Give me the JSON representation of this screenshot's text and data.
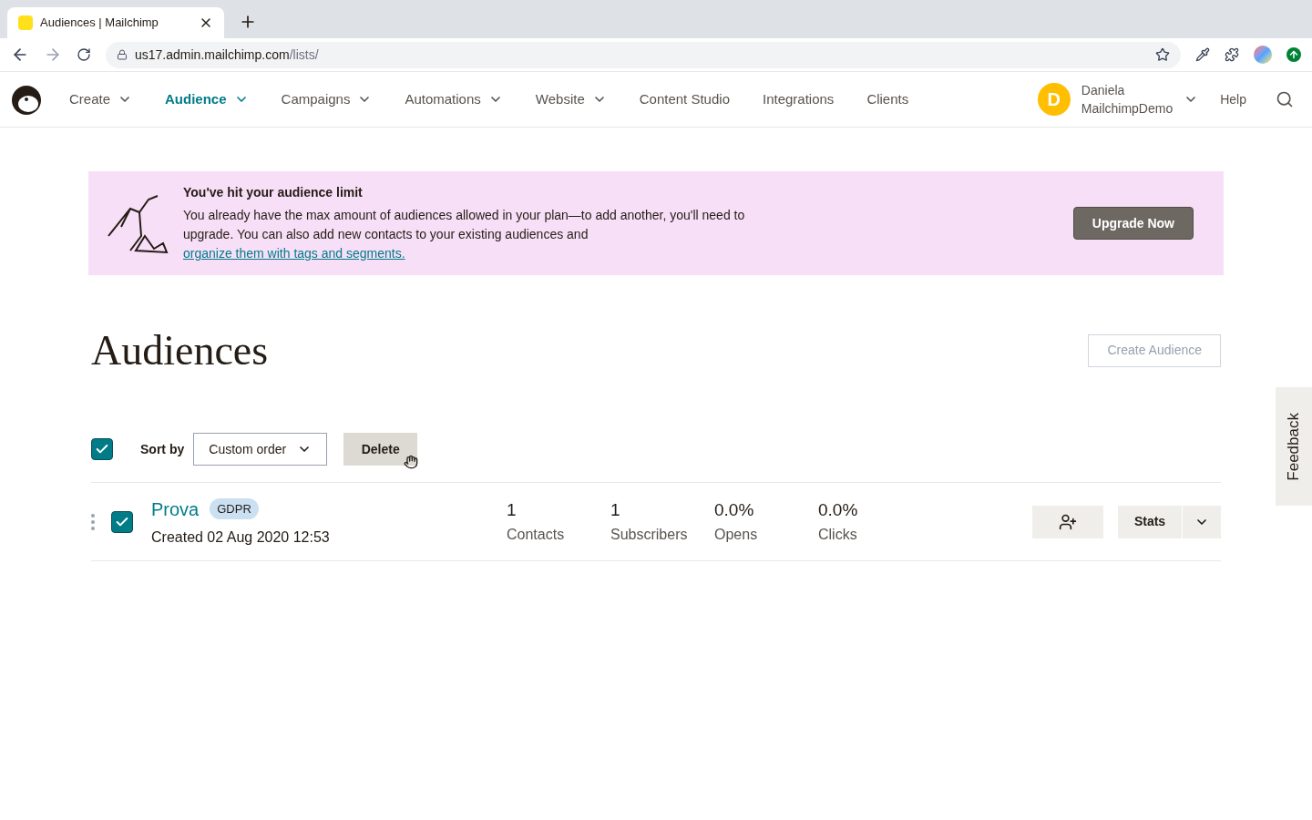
{
  "browser": {
    "tab_title": "Audiences | Mailchimp",
    "url_host": "us17.admin.mailchimp.com",
    "url_path": "/lists/"
  },
  "nav": {
    "items": [
      {
        "label": "Create",
        "dropdown": true,
        "selected": false
      },
      {
        "label": "Audience",
        "dropdown": true,
        "selected": true
      },
      {
        "label": "Campaigns",
        "dropdown": true,
        "selected": false
      },
      {
        "label": "Automations",
        "dropdown": true,
        "selected": false
      },
      {
        "label": "Website",
        "dropdown": true,
        "selected": false
      },
      {
        "label": "Content Studio",
        "dropdown": false,
        "selected": false
      },
      {
        "label": "Integrations",
        "dropdown": false,
        "selected": false
      },
      {
        "label": "Clients",
        "dropdown": false,
        "selected": false
      }
    ],
    "user": {
      "initial": "D",
      "first_name": "Daniela",
      "last_name": "MailchimpDemo"
    },
    "help": "Help"
  },
  "banner": {
    "title": "You've hit your audience limit",
    "body": "You already have the max amount of audiences allowed in your plan—to add another, you'll need to upgrade. You can also add new contacts to your existing audiences and",
    "link": "organize them with tags and segments.",
    "button": "Upgrade Now"
  },
  "page": {
    "title": "Audiences",
    "create_button": "Create Audience"
  },
  "toolbar": {
    "select_all_checked": true,
    "sort_label": "Sort by",
    "sort_value": "Custom order",
    "delete_button": "Delete"
  },
  "audiences": [
    {
      "name": "Prova",
      "tag": "GDPR",
      "created": "Created 02 Aug 2020 12:53",
      "checked": true,
      "stats": [
        {
          "value": "1",
          "label": "Contacts"
        },
        {
          "value": "1",
          "label": "Subscribers"
        },
        {
          "value": "0.0%",
          "label": "Opens"
        },
        {
          "value": "0.0%",
          "label": "Clicks"
        }
      ],
      "stats_button": "Stats"
    }
  ],
  "feedback": "Feedback"
}
